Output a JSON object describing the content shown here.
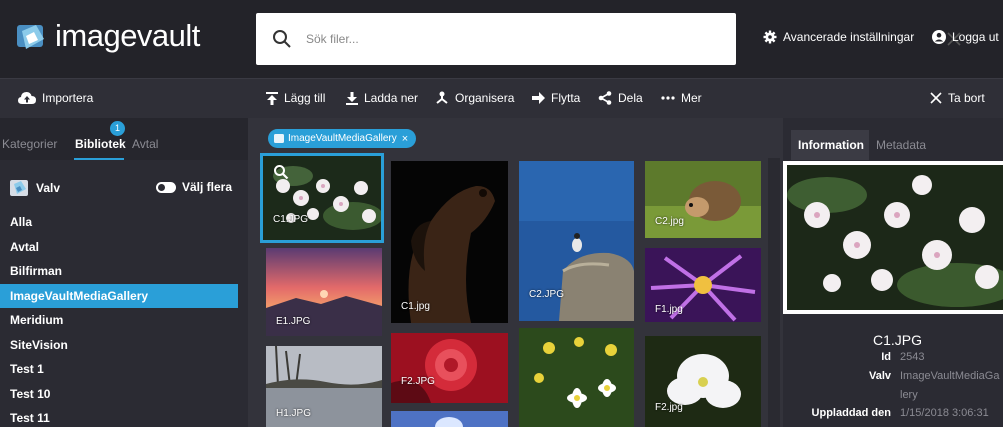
{
  "app": {
    "logo_text": "imagevault"
  },
  "search": {
    "placeholder": "Sök filer...",
    "value": ""
  },
  "top_actions": {
    "advanced": "Avancerade inställningar",
    "logout": "Logga ut"
  },
  "toolbar": {
    "import": "Importera",
    "add": "Lägg till",
    "download": "Ladda ner",
    "organize": "Organisera",
    "move": "Flytta",
    "share": "Dela",
    "more": "Mer",
    "remove": "Ta bort"
  },
  "left": {
    "tabs": [
      {
        "label": "Kategorier"
      },
      {
        "label": "Bibliotek"
      },
      {
        "label": "Avtal"
      }
    ],
    "badge": "1",
    "vault_label": "Valv",
    "select_multiple": "Välj flera",
    "vaults": [
      {
        "label": "Alla"
      },
      {
        "label": "Avtal"
      },
      {
        "label": "Bilfirman"
      },
      {
        "label": "ImageVaultMediaGallery"
      },
      {
        "label": "Meridium"
      },
      {
        "label": "SiteVision"
      },
      {
        "label": "Test 1"
      },
      {
        "label": "Test 10"
      },
      {
        "label": "Test 11"
      }
    ]
  },
  "filter": {
    "chip": "ImageVaultMediaGallery",
    "chip_close": "×"
  },
  "gallery": {
    "items": [
      {
        "label": "C1.JPG"
      },
      {
        "label": "C1.jpg"
      },
      {
        "label": "C2.JPG"
      },
      {
        "label": "C2.jpg"
      },
      {
        "label": "E1.JPG"
      },
      {
        "label": "F1.jpg"
      },
      {
        "label": "F2.JPG"
      },
      {
        "label": "H1.JPG"
      },
      {
        "label": "F2.jpg"
      }
    ]
  },
  "details": {
    "tabs": [
      {
        "label": "Information"
      },
      {
        "label": "Metadata"
      }
    ],
    "title": "C1.JPG",
    "rows": [
      {
        "key": "Id",
        "value": "2543"
      },
      {
        "key": "Valv",
        "value": "ImageVaultMediaGa"
      },
      {
        "key": "",
        "value": "lery"
      },
      {
        "key": "Uppladdad den",
        "value": "1/15/2018 3:06:31"
      }
    ]
  },
  "colors": {
    "accent": "#2a9fd8",
    "topbar": "#232329",
    "panel": "#2b2b33"
  }
}
